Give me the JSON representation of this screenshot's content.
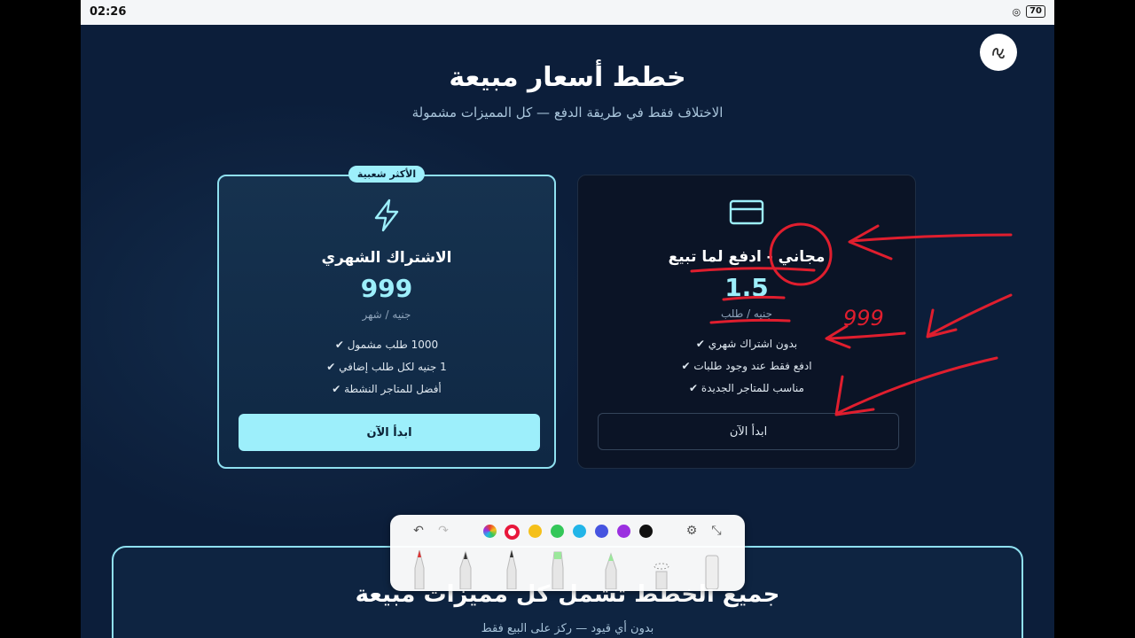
{
  "status": {
    "time": "02:26",
    "battery": "70"
  },
  "hero": {
    "title": "خطط أسعار مبيعة",
    "subtitle": "الاختلاف فقط في طريقة الدفع — كل المميزات مشمولة"
  },
  "plans": [
    {
      "badge": "الأكثر شعبية",
      "icon": "lightning-icon",
      "name": "الاشتراك الشهري",
      "price": "999",
      "unit": "جنيه / شهر",
      "features": [
        "1000 طلب مشمول ✔",
        "1 جنيه لكل طلب إضافي ✔",
        "أفضل للمتاجر النشطة ✔"
      ],
      "cta": "ابدأ الآن"
    },
    {
      "icon": "credit-card-icon",
      "name": "مجاني - ادفع لما تبيع",
      "price": "1.5",
      "unit": "جنيه / طلب",
      "features": [
        "بدون اشتراك شهري ✔",
        "ادفع فقط عند وجود طلبات ✔",
        "مناسب للمتاجر الجديدة ✔"
      ],
      "cta": "ابدأ الآن"
    }
  ],
  "bottom_section": {
    "title": "جميع الخطط تشمل كل مميزات مبيعة",
    "subtitle": "بدون أي قيود — ركز على البيع فقط"
  },
  "annotation": {
    "text": "999",
    "color": "#e01e2e"
  },
  "toolbar": {
    "colors": [
      "#e8402f",
      "#e8173b",
      "#f5c01a",
      "#34c759",
      "#22b5e8",
      "#4654e0",
      "#9b30e0",
      "#111111"
    ],
    "tools": [
      "undo-icon",
      "redo-icon",
      "settings-icon",
      "collapse-icon"
    ],
    "pens": [
      "fountain-pen",
      "calligraphy-pen",
      "pencil",
      "highlighter-green",
      "marker-green",
      "lasso",
      "eraser"
    ]
  },
  "colors": {
    "accent": "#9deffb",
    "background": "#0c1e3a"
  }
}
